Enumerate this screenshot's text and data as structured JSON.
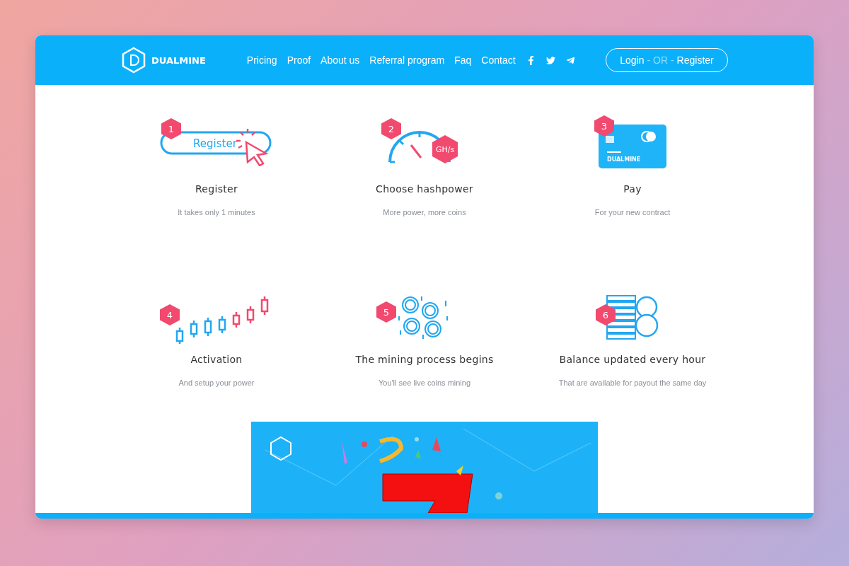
{
  "header": {
    "logo": "DUALMINE",
    "nav": [
      "Pricing",
      "Proof",
      "About us",
      "Referral program",
      "Faq",
      "Contact"
    ],
    "social": [
      {
        "kind": "facebook"
      },
      {
        "kind": "twitter"
      },
      {
        "kind": "telegram"
      }
    ],
    "auth": {
      "login": "Login",
      "separator": "- OR -",
      "register": "Register"
    }
  },
  "steps": [
    {
      "number": "1",
      "kind": "register",
      "art_text": "Register",
      "title": "Register",
      "subtitle": "It takes only 1 minutes"
    },
    {
      "number": "2",
      "kind": "gauge",
      "art_text": "GH/s",
      "title": "Choose hashpower",
      "subtitle": "More power, more coins"
    },
    {
      "number": "3",
      "kind": "card",
      "art_text": "DUALMINE",
      "title": "Pay",
      "subtitle": "For your new contract"
    },
    {
      "number": "4",
      "kind": "chart",
      "title": "Activation",
      "subtitle": "And setup your power"
    },
    {
      "number": "5",
      "kind": "coins",
      "title": "The mining process begins",
      "subtitle": "You'll see live coins mining"
    },
    {
      "number": "6",
      "kind": "stack",
      "title": "Balance updated every hour",
      "subtitle": "That are available for payout the same day"
    }
  ]
}
